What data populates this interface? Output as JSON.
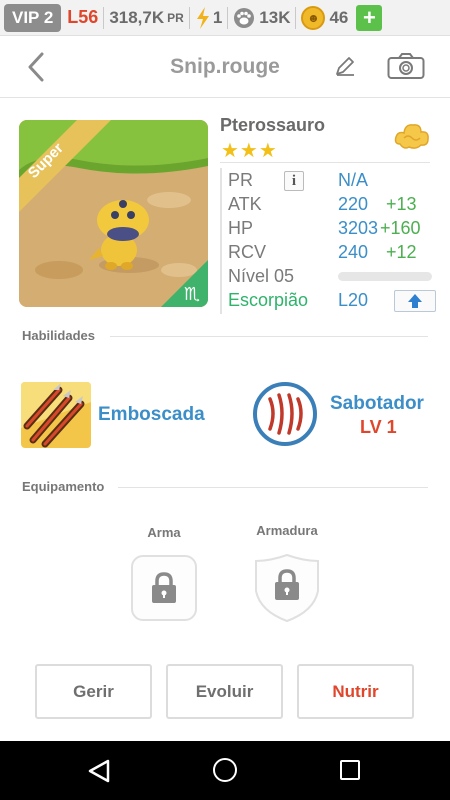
{
  "status": {
    "vip": "VIP 2",
    "level": "L56",
    "pr_value": "318,7K",
    "pr_unit": "PR",
    "energy": "1",
    "paws": "13K",
    "coins": "46",
    "add": "+"
  },
  "header": {
    "title": "Snip.rouge"
  },
  "creature": {
    "badge": "Super",
    "name": "Pterossauro",
    "stars": "★★★",
    "stats": {
      "pr_label": "PR",
      "info_label": "i",
      "pr_value": "N/A",
      "atk_label": "ATK",
      "atk_value": "220",
      "atk_bonus": "+13",
      "hp_label": "HP",
      "hp_value": "3203",
      "hp_bonus": "+160",
      "rcv_label": "RCV",
      "rcv_value": "240",
      "rcv_bonus": "+12",
      "level_label": "Nível 05",
      "level_progress": 0,
      "zodiac_label": "Escorpião",
      "zodiac_level": "L20"
    },
    "zodiac_symbol": "♏"
  },
  "abilities": {
    "title": "Habilidades",
    "items": [
      {
        "name": "Emboscada"
      },
      {
        "name": "Sabotador",
        "level": "LV 1"
      }
    ]
  },
  "equipment": {
    "title": "Equipamento",
    "weapon_label": "Arma",
    "armor_label": "Armadura"
  },
  "actions": {
    "manage": "Gerir",
    "evolve": "Evoluir",
    "feed": "Nutrir"
  },
  "colors": {
    "accent_blue": "#3b8ec8",
    "bonus_green": "#4caf50",
    "alert_red": "#e0462b",
    "zodiac_green": "#2fb36b",
    "star_yellow": "#f2c019"
  }
}
